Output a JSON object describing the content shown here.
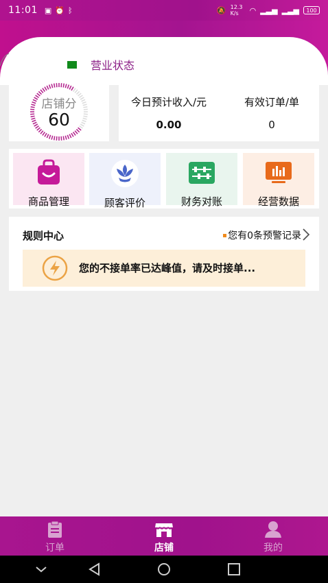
{
  "status_bar": {
    "time": "11:01",
    "left_icons": [
      "message-icon",
      "alarm-icon",
      "bluetooth-icon"
    ],
    "speed": "12.3 K/s",
    "right_icons": [
      "mute-icon",
      "wifi-icon",
      "signal-icon",
      "signal-icon"
    ],
    "battery": "100"
  },
  "header": {
    "status_label": "营业状态",
    "status_color": "#118a1c"
  },
  "score": {
    "title": "店铺分",
    "value": "60"
  },
  "income": {
    "revenue_label": "今日预计收入/元",
    "revenue_value": "0.00",
    "orders_label": "有效订单/单",
    "orders_value": "0"
  },
  "menu": [
    {
      "label": "商品管理",
      "icon": "bag-icon",
      "bg": "#fbe6f2"
    },
    {
      "label": "顾客评价",
      "icon": "flower-icon",
      "bg": "#eef1fb"
    },
    {
      "label": "财务对账",
      "icon": "abacus-icon",
      "bg": "#e9f5ee"
    },
    {
      "label": "经营数据",
      "icon": "chart-icon",
      "bg": "#fdeee4"
    }
  ],
  "rules": {
    "title": "规则中心",
    "link": "您有0条预警记录",
    "warning": "您的不接单率已达峰值，请及时接单..."
  },
  "tabs": [
    {
      "label": "订单",
      "icon": "clipboard-icon",
      "active": false
    },
    {
      "label": "店铺",
      "icon": "store-icon",
      "active": true
    },
    {
      "label": "我的",
      "icon": "user-icon",
      "active": false
    }
  ],
  "colors": {
    "brand": "#a0128c",
    "accent_orange": "#f08a1c",
    "warning_bg": "#fdefd9"
  }
}
